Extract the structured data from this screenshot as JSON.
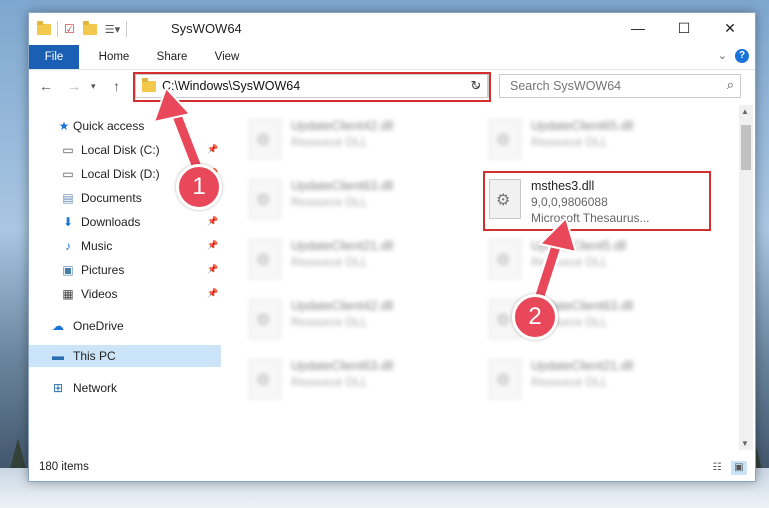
{
  "window": {
    "title": "SysWOW64"
  },
  "ribbon": {
    "tabs": [
      "File",
      "Home",
      "Share",
      "View"
    ],
    "help": "?"
  },
  "navigation": {
    "address": "C:\\Windows\\SysWOW64",
    "search_placeholder": "Search SysWOW64"
  },
  "sidebar": {
    "items": [
      {
        "label": "Quick access",
        "icon": "star-icon"
      },
      {
        "label": "Local Disk (C:)",
        "icon": "drive-icon"
      },
      {
        "label": "Local Disk (D:)",
        "icon": "drive-icon"
      },
      {
        "label": "Documents",
        "icon": "documents-icon"
      },
      {
        "label": "Downloads",
        "icon": "download-icon"
      },
      {
        "label": "Music",
        "icon": "music-icon"
      },
      {
        "label": "Pictures",
        "icon": "pictures-icon"
      },
      {
        "label": "Videos",
        "icon": "videos-icon"
      },
      {
        "label": "OneDrive",
        "icon": "cloud-icon"
      },
      {
        "label": "This PC",
        "icon": "computer-icon"
      },
      {
        "label": "Network",
        "icon": "network-icon"
      }
    ],
    "selected": "This PC"
  },
  "files": [
    {
      "name": "UpdateClient42.dll",
      "desc": "Resource DLL",
      "blurred": true
    },
    {
      "name": "UpdateClient65.dll",
      "desc": "Resource DLL",
      "blurred": true
    },
    {
      "name": "UpdateClient63.dll",
      "desc": "Resource DLL",
      "blurred": true
    },
    {
      "name": "msthes3.dll",
      "desc": "9,0,0,9806088",
      "desc2": "Microsoft Thesaurus...",
      "blurred": false
    },
    {
      "name": "UpdateClient21.dll",
      "desc": "Resource DLL",
      "blurred": true
    },
    {
      "name": "UpdateClient5.dll",
      "desc": "Resource DLL",
      "blurred": true
    },
    {
      "name": "UpdateClient42.dll",
      "desc": "Resource DLL",
      "blurred": true
    },
    {
      "name": "UpdateClient63.dll",
      "desc": "Resource DLL",
      "blurred": true
    },
    {
      "name": "UpdateClient63.dll",
      "desc": "Resource DLL",
      "blurred": true
    },
    {
      "name": "UpdateClient21.dll",
      "desc": "Resource DLL",
      "blurred": true
    }
  ],
  "status": {
    "item_count": "180 items"
  },
  "callouts": {
    "step1": "1",
    "step2": "2"
  },
  "colors": {
    "accent": "#1a5fb4",
    "highlight": "#d32f2f",
    "callout": "#e8485a",
    "selected_bg": "#cce4f7"
  }
}
